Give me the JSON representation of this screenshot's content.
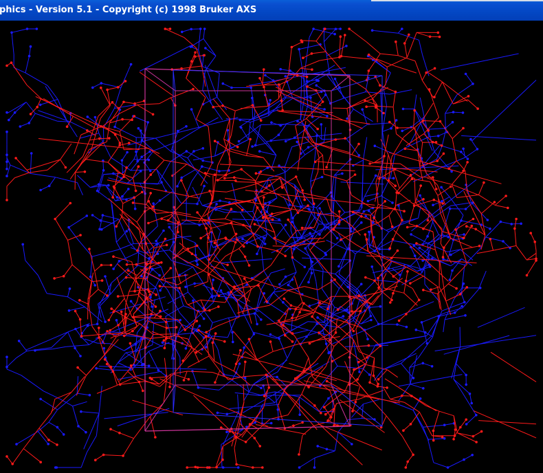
{
  "window": {
    "title": "phics - Version 5.1 - Copyright (c) 1998 Bruker AXS"
  },
  "viewport": {
    "background": "#000000",
    "structure_colors": {
      "primary": "#ff1a1a",
      "secondary": "#1a1aff",
      "unit_cell": "#cc3399"
    }
  }
}
